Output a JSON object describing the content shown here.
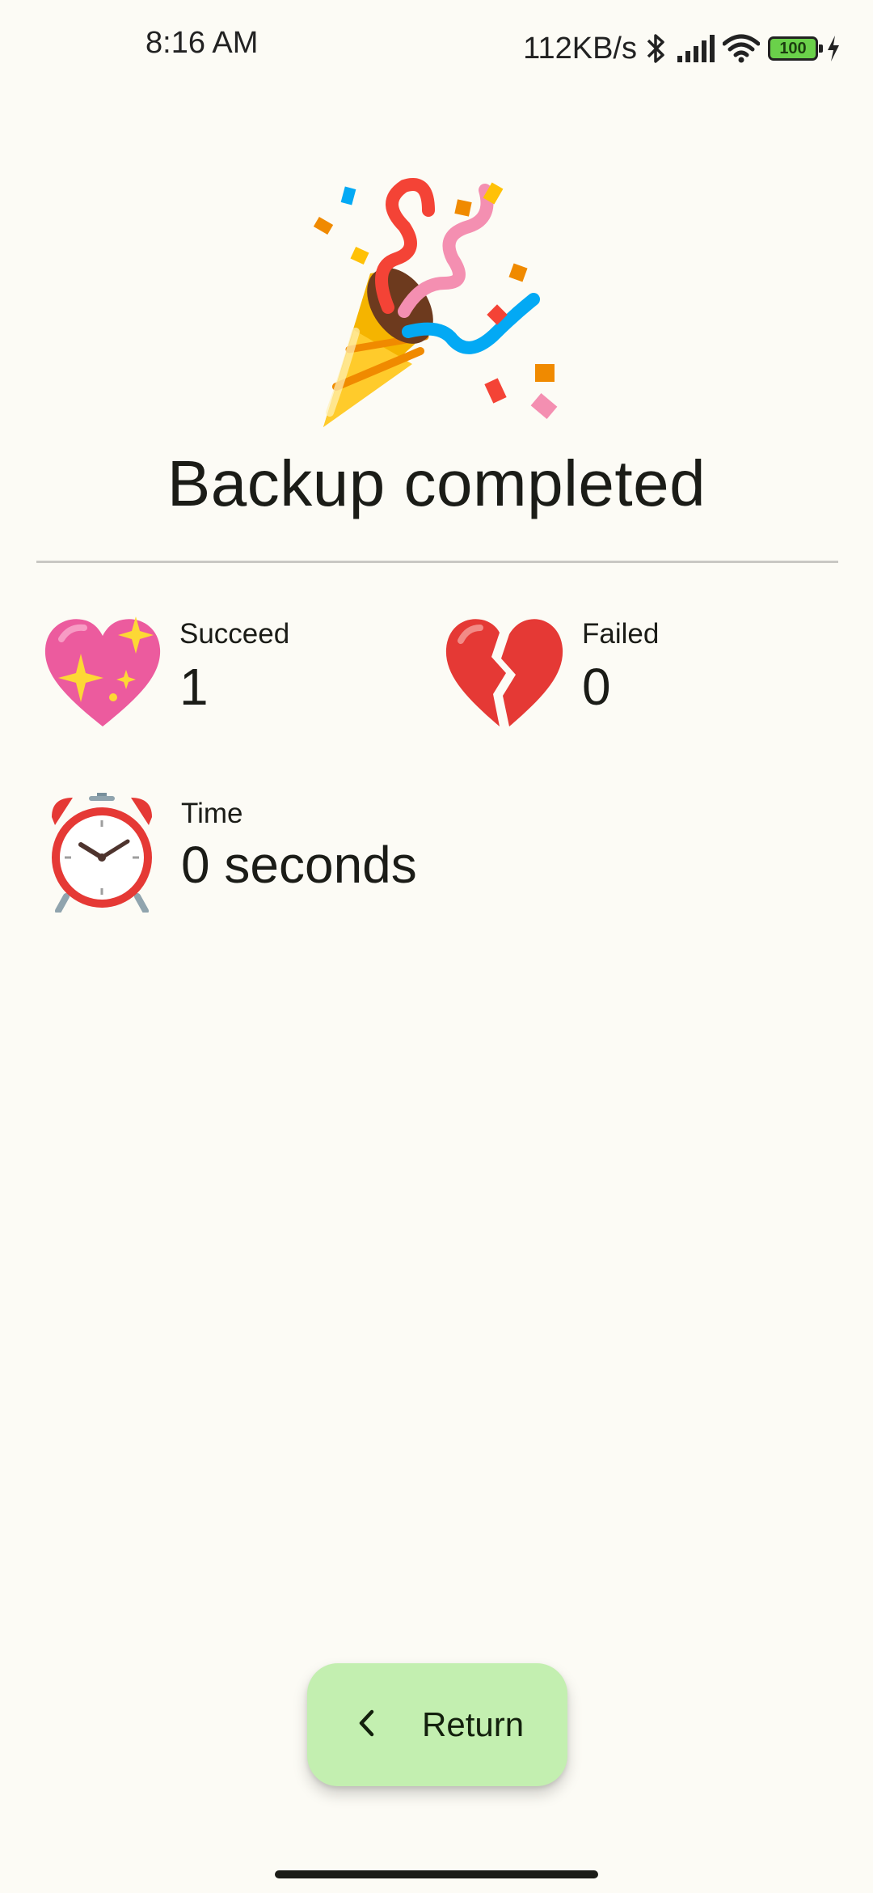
{
  "status_bar": {
    "time": "8:16 AM",
    "network_speed": "112KB/s",
    "battery_level": "100",
    "icons": [
      "bluetooth-icon",
      "signal-icon",
      "wifi-icon",
      "battery-icon",
      "charging-icon"
    ]
  },
  "hero": {
    "icon": "party-popper-icon",
    "title": "Backup completed"
  },
  "stats": {
    "succeed": {
      "icon": "sparkling-heart-icon",
      "label": "Succeed",
      "value": "1"
    },
    "failed": {
      "icon": "broken-heart-icon",
      "label": "Failed",
      "value": "0"
    },
    "time": {
      "icon": "alarm-clock-icon",
      "label": "Time",
      "value": "0 seconds"
    }
  },
  "return_button": {
    "icon": "chevron-left-icon",
    "label": "Return",
    "color": "#c3efb0"
  },
  "colors": {
    "background": "#fcfbf5",
    "text": "#1b1c17"
  }
}
